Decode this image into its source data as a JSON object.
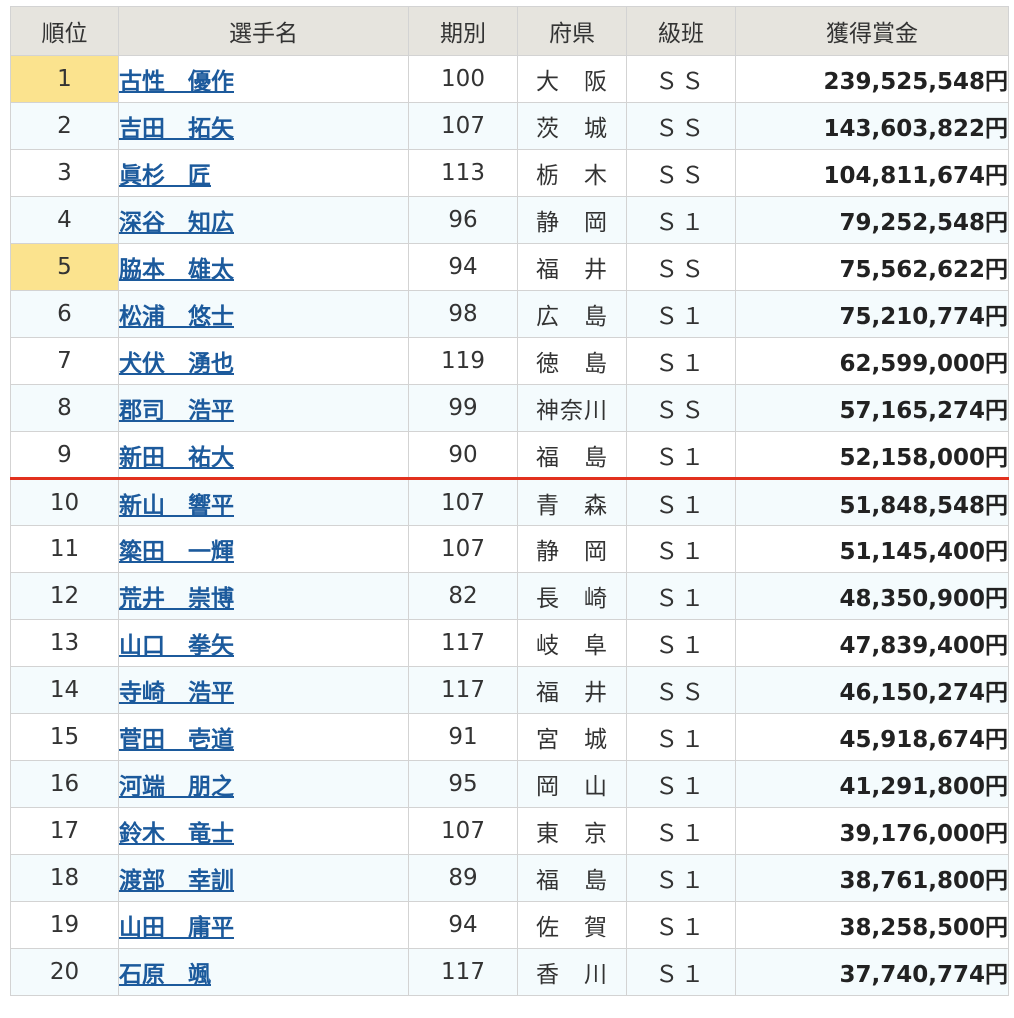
{
  "headers": {
    "rank": "順位",
    "name": "選手名",
    "term": "期別",
    "pref": "府県",
    "class": "級班",
    "prize": "獲得賞金"
  },
  "highlight_color": "#fbe38e",
  "cutline_color": "#e2311e",
  "link_color": "#1c5a9c",
  "rows": [
    {
      "rank": "1",
      "name": "古性　優作",
      "term": "100",
      "pref": "大　阪",
      "class": "ＳＳ",
      "prize": "239,525,548円"
    },
    {
      "rank": "2",
      "name": "吉田　拓矢",
      "term": "107",
      "pref": "茨　城",
      "class": "ＳＳ",
      "prize": "143,603,822円"
    },
    {
      "rank": "3",
      "name": "眞杉　匠",
      "term": "113",
      "pref": "栃　木",
      "class": "ＳＳ",
      "prize": "104,811,674円"
    },
    {
      "rank": "4",
      "name": "深谷　知広",
      "term": "96",
      "pref": "静　岡",
      "class": "Ｓ１",
      "prize": "79,252,548円"
    },
    {
      "rank": "5",
      "name": "脇本　雄太",
      "term": "94",
      "pref": "福　井",
      "class": "ＳＳ",
      "prize": "75,562,622円"
    },
    {
      "rank": "6",
      "name": "松浦　悠士",
      "term": "98",
      "pref": "広　島",
      "class": "Ｓ１",
      "prize": "75,210,774円"
    },
    {
      "rank": "7",
      "name": "犬伏　湧也",
      "term": "119",
      "pref": "徳　島",
      "class": "Ｓ１",
      "prize": "62,599,000円"
    },
    {
      "rank": "8",
      "name": "郡司　浩平",
      "term": "99",
      "pref": "神奈川",
      "class": "ＳＳ",
      "prize": "57,165,274円"
    },
    {
      "rank": "9",
      "name": "新田　祐大",
      "term": "90",
      "pref": "福　島",
      "class": "Ｓ１",
      "prize": "52,158,000円"
    },
    {
      "rank": "10",
      "name": "新山　響平",
      "term": "107",
      "pref": "青　森",
      "class": "Ｓ１",
      "prize": "51,848,548円"
    },
    {
      "rank": "11",
      "name": "簗田　一輝",
      "term": "107",
      "pref": "静　岡",
      "class": "Ｓ１",
      "prize": "51,145,400円"
    },
    {
      "rank": "12",
      "name": "荒井　崇博",
      "term": "82",
      "pref": "長　崎",
      "class": "Ｓ１",
      "prize": "48,350,900円"
    },
    {
      "rank": "13",
      "name": "山口　拳矢",
      "term": "117",
      "pref": "岐　阜",
      "class": "Ｓ１",
      "prize": "47,839,400円"
    },
    {
      "rank": "14",
      "name": "寺崎　浩平",
      "term": "117",
      "pref": "福　井",
      "class": "ＳＳ",
      "prize": "46,150,274円"
    },
    {
      "rank": "15",
      "name": "菅田　壱道",
      "term": "91",
      "pref": "宮　城",
      "class": "Ｓ１",
      "prize": "45,918,674円"
    },
    {
      "rank": "16",
      "name": "河端　朋之",
      "term": "95",
      "pref": "岡　山",
      "class": "Ｓ１",
      "prize": "41,291,800円"
    },
    {
      "rank": "17",
      "name": "鈴木　竜士",
      "term": "107",
      "pref": "東　京",
      "class": "Ｓ１",
      "prize": "39,176,000円"
    },
    {
      "rank": "18",
      "name": "渡部　幸訓",
      "term": "89",
      "pref": "福　島",
      "class": "Ｓ１",
      "prize": "38,761,800円"
    },
    {
      "rank": "19",
      "name": "山田　庸平",
      "term": "94",
      "pref": "佐　賀",
      "class": "Ｓ１",
      "prize": "38,258,500円"
    },
    {
      "rank": "20",
      "name": "石原　颯",
      "term": "117",
      "pref": "香　川",
      "class": "Ｓ１",
      "prize": "37,740,774円"
    }
  ]
}
